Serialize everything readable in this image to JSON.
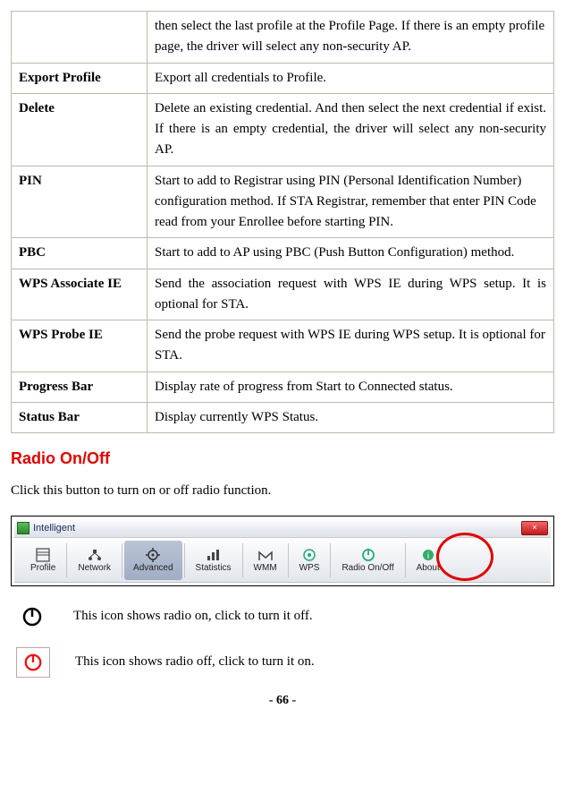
{
  "table": {
    "rows": [
      {
        "term": "",
        "desc": "then select the last profile at the Profile Page. If there is an empty profile page, the driver will select any non-security AP.",
        "justify": false
      },
      {
        "term": "Export Profile",
        "desc": "Export all credentials to Profile.",
        "justify": false
      },
      {
        "term": "Delete",
        "desc": "Delete an existing credential. And then select the next credential if exist. If there is an empty credential, the driver will select any non-security AP.",
        "justify": true
      },
      {
        "term": "PIN",
        "desc": "Start to add to Registrar using PIN (Personal Identification Number) configuration method. If STA Registrar, remember that enter PIN Code read from your Enrollee before starting PIN.",
        "justify": false
      },
      {
        "term": "PBC",
        "desc": "Start to add to AP using PBC (Push Button Configuration) method.",
        "justify": false
      },
      {
        "term": "WPS Associate IE",
        "desc": "Send the association request with WPS IE during WPS setup. It is optional for STA.",
        "justify": true
      },
      {
        "term": "WPS Probe IE",
        "desc": "Send the probe request with WPS IE during WPS setup. It is optional for STA.",
        "justify": false
      },
      {
        "term": "Progress Bar",
        "desc": "Display rate of progress from Start to Connected status.",
        "justify": false
      },
      {
        "term": "Status Bar",
        "desc": "Display currently WPS Status.",
        "justify": false
      }
    ]
  },
  "section": {
    "heading": "Radio On/Off",
    "intro": "Click this button to turn on or off radio function."
  },
  "screenshot": {
    "title": "Intelligent",
    "close": "×",
    "toolbar": [
      {
        "label": "Profile",
        "active": false
      },
      {
        "label": "Network",
        "active": false
      },
      {
        "label": "Advanced",
        "active": true
      },
      {
        "label": "Statistics",
        "active": false
      },
      {
        "label": "WMM",
        "active": false
      },
      {
        "label": "WPS",
        "active": false
      },
      {
        "label": "Radio On/Off",
        "active": false
      },
      {
        "label": "About",
        "active": false
      }
    ]
  },
  "legends": [
    {
      "text": "This icon shows radio on, click to turn it off."
    },
    {
      "text": "This icon shows radio off, click to turn it on."
    }
  ],
  "page_number": "- 66 -"
}
